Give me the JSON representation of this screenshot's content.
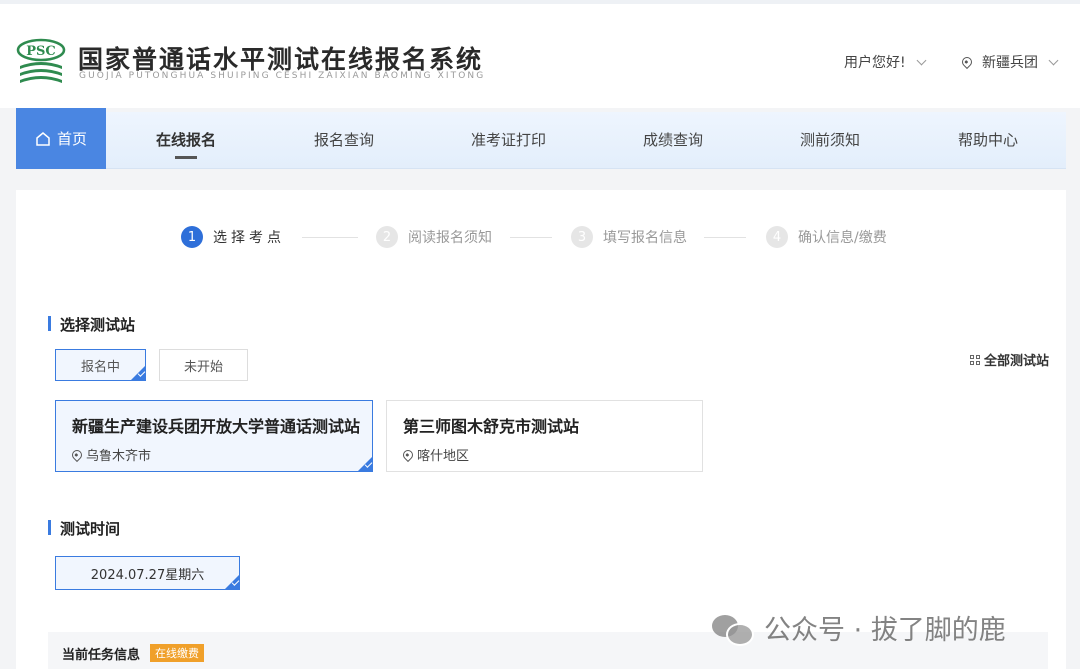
{
  "header": {
    "logo_text": "PSC",
    "title": "国家普通话水平测试在线报名系统",
    "subtitle": "GUOJIA PUTONGHUA SHUIPING CESHI ZAIXIAN BAOMING XITONG",
    "user_menu": "用户您好!",
    "region": "新疆兵团"
  },
  "nav": {
    "home": "首页",
    "items": [
      {
        "label": "在线报名",
        "active": true
      },
      {
        "label": "报名查询"
      },
      {
        "label": "准考证打印"
      },
      {
        "label": "成绩查询"
      },
      {
        "label": "测前须知"
      },
      {
        "label": "帮助中心"
      }
    ]
  },
  "steps": [
    {
      "num": "1",
      "label": "选择考点",
      "active": true
    },
    {
      "num": "2",
      "label": "阅读报名须知"
    },
    {
      "num": "3",
      "label": "填写报名信息"
    },
    {
      "num": "4",
      "label": "确认信息/缴费"
    }
  ],
  "station_section": {
    "title": "选择测试站",
    "tabs": [
      {
        "label": "报名中",
        "selected": true
      },
      {
        "label": "未开始"
      }
    ],
    "all_link": "全部测试站",
    "stations": [
      {
        "name": "新疆生产建设兵团开放大学普通话测试站",
        "location": "乌鲁木齐市",
        "selected": true
      },
      {
        "name": "第三师图木舒克市测试站",
        "location": "喀什地区"
      }
    ]
  },
  "time_section": {
    "title": "测试时间",
    "dates": [
      {
        "label": "2024.07.27星期六",
        "selected": true
      }
    ]
  },
  "task": {
    "title": "当前任务信息",
    "badge": "在线缴费"
  },
  "watermark": {
    "text": "公众号 · 拔了脚的鹿"
  },
  "colors": {
    "primary": "#3a7be0",
    "nav_home_bg": "#4a86e2",
    "badge": "#f0a02a"
  }
}
